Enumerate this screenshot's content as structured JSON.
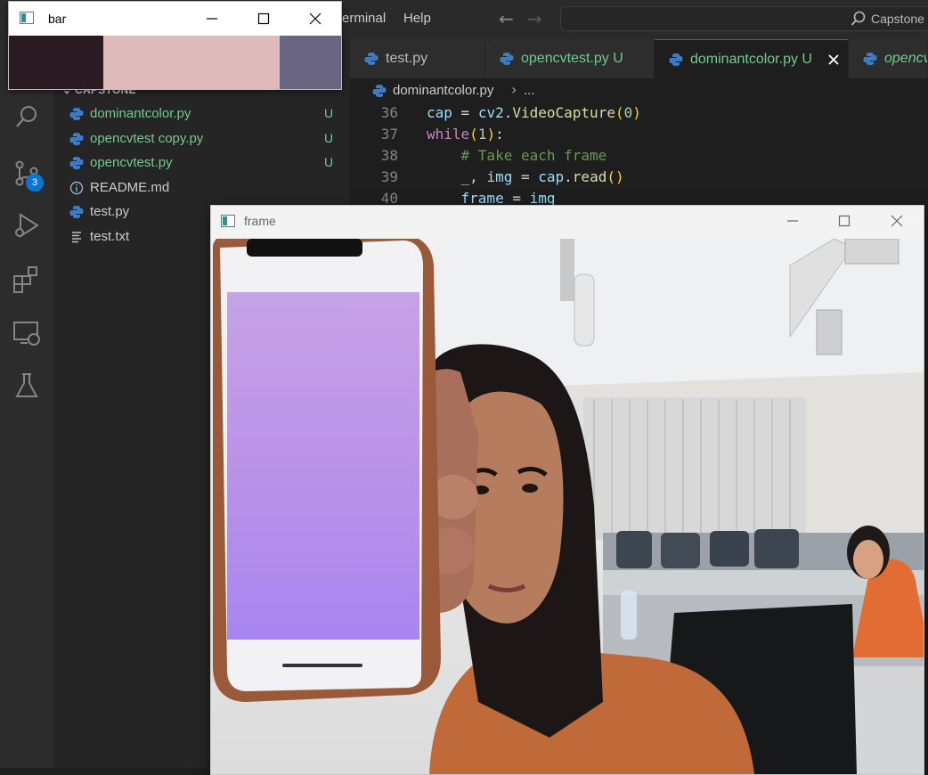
{
  "vscode": {
    "menu": [
      "erminal",
      "Help"
    ],
    "search_text": "Capstone",
    "scm_badge": "3",
    "explorer_header": "CAPSTONE",
    "files": [
      {
        "name": "dominantcolor.py",
        "status": "U",
        "icon": "python-icon"
      },
      {
        "name": "opencvtest copy.py",
        "status": "U",
        "icon": "python-icon"
      },
      {
        "name": "opencvtest.py",
        "status": "U",
        "icon": "python-icon"
      },
      {
        "name": "README.md",
        "status": "",
        "icon": "info-icon"
      },
      {
        "name": "test.py",
        "status": "",
        "icon": "python-icon"
      },
      {
        "name": "test.txt",
        "status": "",
        "icon": "text-file-icon"
      }
    ],
    "tabs": [
      {
        "label": "test.py",
        "status": ""
      },
      {
        "label": "opencvtest.py",
        "status": "U"
      },
      {
        "label": "dominantcolor.py",
        "status": "U",
        "active": true
      },
      {
        "label": "opencv",
        "status": ""
      }
    ],
    "breadcrumb": {
      "file": "dominantcolor.py",
      "more": "..."
    },
    "code": [
      {
        "line": "36",
        "text": "cap = cv2.VideoCapture(0)"
      },
      {
        "line": "37",
        "text": "while(1):"
      },
      {
        "line": "38",
        "text": "    # Take each frame"
      },
      {
        "line": "39",
        "text": "    _, img = cap.read()"
      },
      {
        "line": "40",
        "text": "    frame = img"
      }
    ]
  },
  "bar_window": {
    "title": "bar",
    "swatches": [
      {
        "color": "#2a1b22",
        "fraction": 0.285
      },
      {
        "color": "#dfbbbb",
        "fraction": 0.53
      },
      {
        "color": "#6a6682",
        "fraction": 0.185
      }
    ]
  },
  "frame_window": {
    "title": "frame"
  },
  "colors": {
    "accent": "#0078d4",
    "untracked": "#73c991",
    "editor_bg": "#1e1e1e"
  }
}
